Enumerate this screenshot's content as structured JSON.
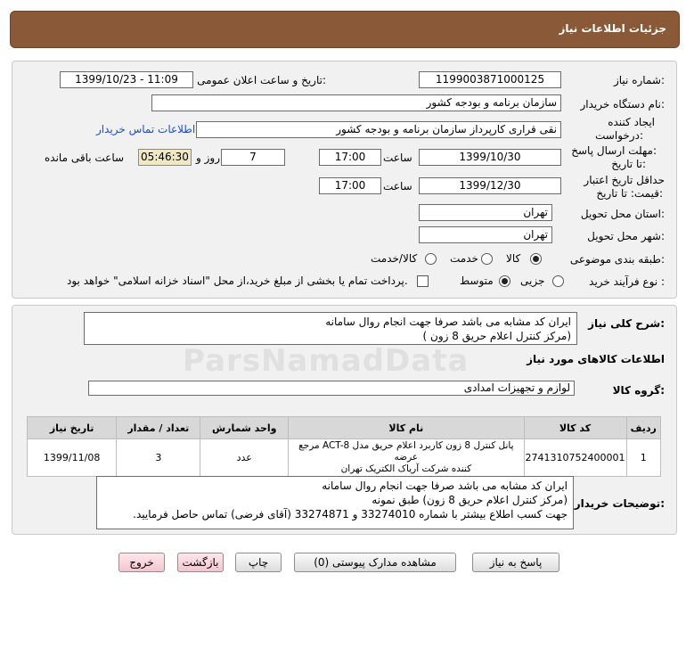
{
  "header": {
    "title": "جزئیات اطلاعات نیاز"
  },
  "form": {
    "need_number_label": "شماره نیاز:",
    "need_number": "1199003871000125",
    "announce_label": "تاریخ و ساعت اعلان عمومی:",
    "announce_value": "1399/10/23 - 11:09",
    "buyer_org_label": "نام دستگاه خریدار:",
    "buyer_org": "سازمان برنامه و بودجه کشور",
    "requester_label_1": "ایجاد کننده",
    "requester_label_2": "درخواست:",
    "requester": "نقی قراری کارپرداز سازمان برنامه و بودجه کشور",
    "contact_link": "اطلاعات تماس خریدار",
    "deadline_label_1": "مهلت ارسال پاسخ:",
    "deadline_label_2": "تا تاریخ:",
    "deadline_date": "1399/10/30",
    "time_label": "ساعت",
    "deadline_time": "17:00",
    "days_value": "7",
    "days_label": "روز و",
    "remaining_time": "05:46:30",
    "remaining_label": "ساعت باقی مانده",
    "validity_label_1": "حداقل تاریخ اعتبار",
    "validity_label_2": "قیمت: تا تاریخ:",
    "validity_date": "1399/12/30",
    "validity_time": "17:00",
    "province_label": "استان محل تحویل:",
    "province": "تهران",
    "city_label": "شهر محل تحویل:",
    "city": "تهران",
    "category_label": "طبقه بندی موضوعی:",
    "category_options": [
      "کالا",
      "خدمت",
      "کالا/خدمت"
    ],
    "purchase_type_label": "نوع فرآیند خرید :",
    "purchase_options": [
      "جزیی",
      "متوسط"
    ],
    "payment_note": "پرداخت تمام یا بخشی از مبلغ خرید،از محل \"اسناد خزانه اسلامی\" خواهد بود."
  },
  "summary": {
    "label": "شرح کلی نیاز:",
    "line1": "ایران کد مشابه می باشد صرفا جهت انجام روال سامانه",
    "line2": "(مرکز کنترل اعلام حریق 8 زون )"
  },
  "goods": {
    "section_title": "اطلاعات کالاهای مورد نیاز",
    "group_label": "گروه کالا:",
    "group_value": "لوازم و تجهیزات امدادی"
  },
  "table": {
    "headers": [
      "ردیف",
      "کد کالا",
      "نام کالا",
      "واحد شمارش",
      "تعداد / مقدار",
      "تاریخ نیاز"
    ],
    "rows": [
      {
        "index": "1",
        "code": "2741310752400001",
        "name_line1": "پانل کنترل 8 زون کاربرد اعلام حریق مدل ACT-8 مرجع عرضه",
        "name_line2": "کننده شرکت آریاک الکتریک تهران",
        "unit": "عدد",
        "qty": "3",
        "date": "1399/11/08"
      }
    ]
  },
  "buyer_notes": {
    "label": "توضیحات خریدار:",
    "line1": "ایران کد مشابه می باشد صرفا جهت انجام روال سامانه",
    "line2": "(مرکز کنترل اعلام حریق 8 زون) طبق نمونه",
    "line3": "جهت کسب اطلاع بیشتر با شماره 33274010 و 33274871 (آقای فرضی) تماس حاصل فرمایید."
  },
  "buttons": {
    "reply": "پاسخ به نیاز",
    "attachments": "مشاهده مدارک پیوستی (0)",
    "print": "چاپ",
    "back": "بازگشت",
    "exit": "خروج"
  },
  "watermark": {
    "text": "ParsNamadData"
  },
  "colors": {
    "header": "#8a5a38",
    "timer_bg": "#efe8c3",
    "link": "#1f4fbf",
    "pink_button": "#f4c6cf"
  }
}
